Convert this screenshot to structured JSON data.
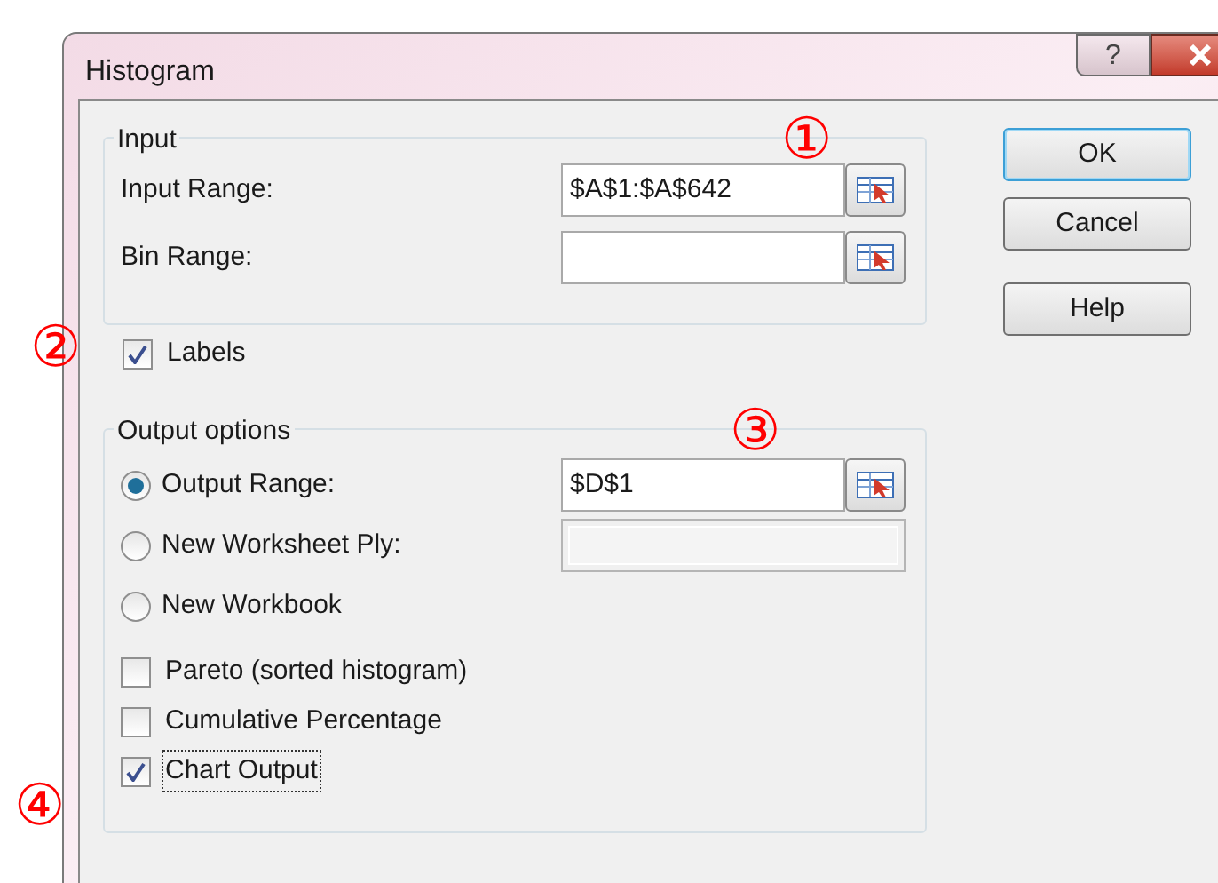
{
  "window": {
    "title": "Histogram",
    "help_label": "?"
  },
  "input_group": {
    "title": "Input",
    "fields": [
      {
        "label": "Input Range:",
        "value": "$A$1:$A$642"
      },
      {
        "label": "Bin Range:"
      }
    ]
  },
  "labels_checkbox": {
    "label": "Labels",
    "checked": true,
    "focused": false
  },
  "output_group": {
    "title": "Output options",
    "options": [
      {
        "label": "Output Range:",
        "selected": true,
        "field": {
          "value": "$D$1",
          "disabled": false
        }
      },
      {
        "label": "New Worksheet Ply:",
        "selected": false,
        "field": {
          "disabled": true
        }
      },
      {
        "label": "New Workbook",
        "selected": false
      }
    ],
    "checkboxes": [
      {
        "label": "Pareto (sorted histogram)",
        "checked": false,
        "focused": false
      },
      {
        "label": "Cumulative Percentage",
        "checked": false,
        "focused": false
      },
      {
        "label": "Chart Output",
        "checked": true,
        "focused": true
      }
    ]
  },
  "buttons": [
    {
      "label": "OK",
      "default": true
    },
    {
      "label": "Cancel",
      "default": false
    },
    {
      "label": "Help",
      "default": false
    }
  ],
  "callouts": [
    "①",
    "②",
    "③",
    "④"
  ]
}
